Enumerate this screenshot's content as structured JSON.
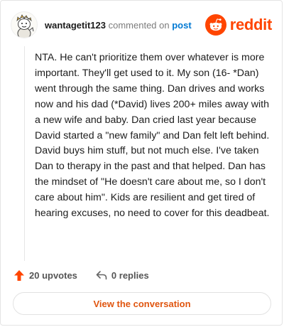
{
  "header": {
    "username": "wantagetit123",
    "action_text": "commented on",
    "post_link": "post",
    "brand_name": "reddit"
  },
  "comment": {
    "text": "NTA. He can't prioritize them over whatever is more important. They'll get used to it. My son (16- *Dan) went through the same thing. Dan drives and works now and his dad (*David) lives 200+ miles away with a new wife and baby. Dan cried last year because David started a \"new family\" and Dan felt left behind. David buys him stuff, but not much else. I've taken Dan to therapy in the past and that helped. Dan has the mindset of \"He doesn't care about me, so I don't care about him\". Kids are resilient and get tired of hearing excuses, no need to cover for this deadbeat."
  },
  "actions": {
    "upvotes": "20 upvotes",
    "replies": "0 replies"
  },
  "view_button": "View the conversation",
  "colors": {
    "brand": "#ff4500",
    "link": "#0079d3",
    "upvote": "#ff4500",
    "button_text": "#e0550f"
  },
  "icons": {
    "avatar": "user-avatar",
    "brand": "reddit-logo-icon",
    "upvote": "upvote-arrow-icon",
    "reply": "reply-arrow-icon"
  }
}
